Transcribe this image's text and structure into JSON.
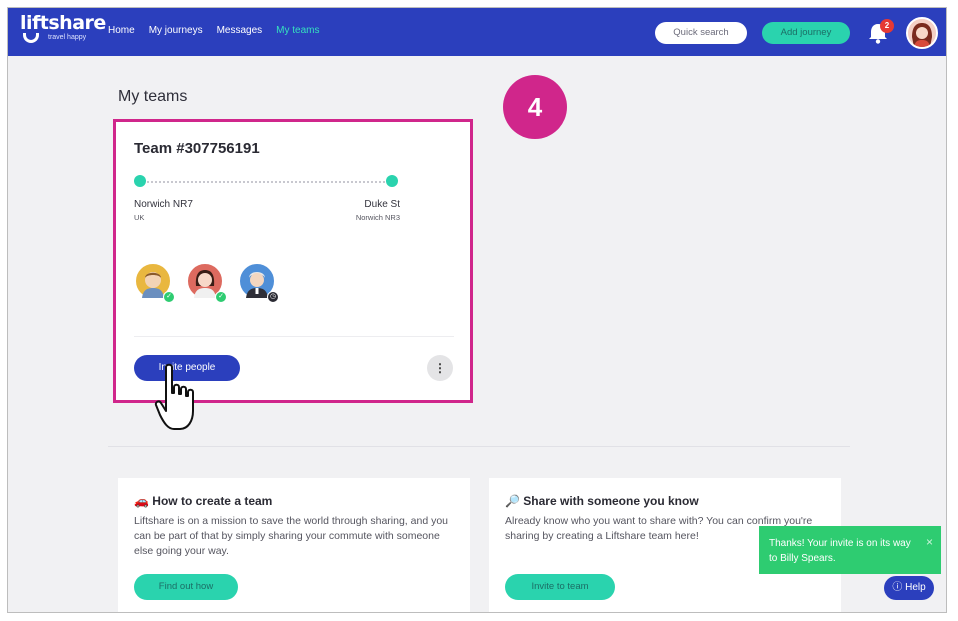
{
  "brand": {
    "name": "liftshare",
    "tagline": "travel happy"
  },
  "nav": {
    "links": [
      {
        "label": "Home",
        "active": false
      },
      {
        "label": "My journeys",
        "active": false
      },
      {
        "label": "Messages",
        "active": false
      },
      {
        "label": "My teams",
        "active": true
      }
    ],
    "quick_search": "Quick search",
    "add_journey": "Add journey",
    "notification_count": "2",
    "accent_color": "#35e0bf"
  },
  "page": {
    "title": "My teams",
    "step_number": "4"
  },
  "team_card": {
    "title": "Team #307756191",
    "from": {
      "name": "Norwich NR7",
      "sub": "UK"
    },
    "to": {
      "name": "Duke St",
      "sub": "Norwich NR3"
    },
    "members": [
      {
        "status": "confirmed",
        "status_icon": "check-icon"
      },
      {
        "status": "confirmed",
        "status_icon": "check-icon"
      },
      {
        "status": "pending",
        "status_icon": "clock-icon"
      }
    ],
    "invite_label": "Invite people",
    "more_icon": "ellipsis-vertical-icon",
    "highlight_color": "#d0268b"
  },
  "info_cards": [
    {
      "icon": "car-icon",
      "title": "How to create a team",
      "text": "Liftshare is on a mission to save the world through sharing, and you can be part of that by simply sharing your commute with someone else going your way.",
      "button": "Find out how"
    },
    {
      "icon": "magnifier-icon",
      "title": "Share with someone you know",
      "text": "Already know who you want to share with? You can confirm you're sharing by creating a Liftshare team here!",
      "button": "Invite to team"
    }
  ],
  "toast": {
    "message": "Thanks! Your invite is on its way to Billy Spears.",
    "close": "×"
  },
  "help": {
    "label": "Help"
  },
  "colors": {
    "primary": "#2b3fbd",
    "teal": "#2ad3ae",
    "magenta": "#d0268b",
    "success": "#2ecc71"
  }
}
